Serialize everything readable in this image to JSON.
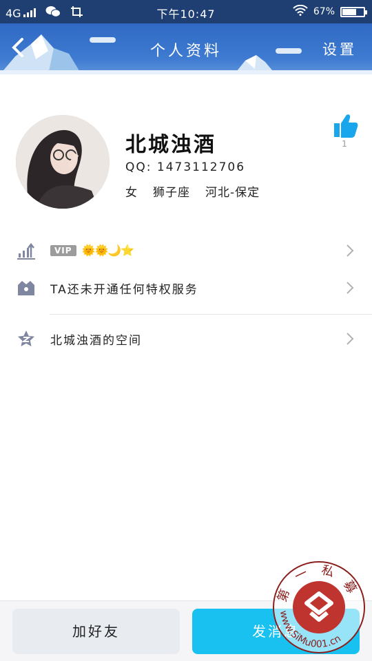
{
  "status_bar": {
    "network": "4G",
    "time": "下午10:47",
    "battery_percent": "67%",
    "battery_level": 0.67
  },
  "header": {
    "title": "个人资料",
    "settings_label": "设置"
  },
  "profile": {
    "name": "北城浊酒",
    "qq": "QQ: 1473112706",
    "gender": "女",
    "zodiac": "狮子座",
    "location": "河北-保定",
    "like_count": "1"
  },
  "list": {
    "vip_tag": "VIP",
    "vip_level_icons": "🌞🌞🌙⭐",
    "privilege_label": "TA还未开通任何特权服务",
    "space_label": "北城浊酒的空间"
  },
  "actions": {
    "add_friend": "加好友",
    "send_message": "发消息"
  },
  "watermark": {
    "text_top": "第 一 私 募",
    "text_bottom": "www.SiMu001.cn"
  },
  "colors": {
    "header_blue": "#3f7bd1",
    "accent_cyan": "#19c1f0",
    "like_blue": "#1aa6ec",
    "watermark_red": "#c0342f"
  }
}
